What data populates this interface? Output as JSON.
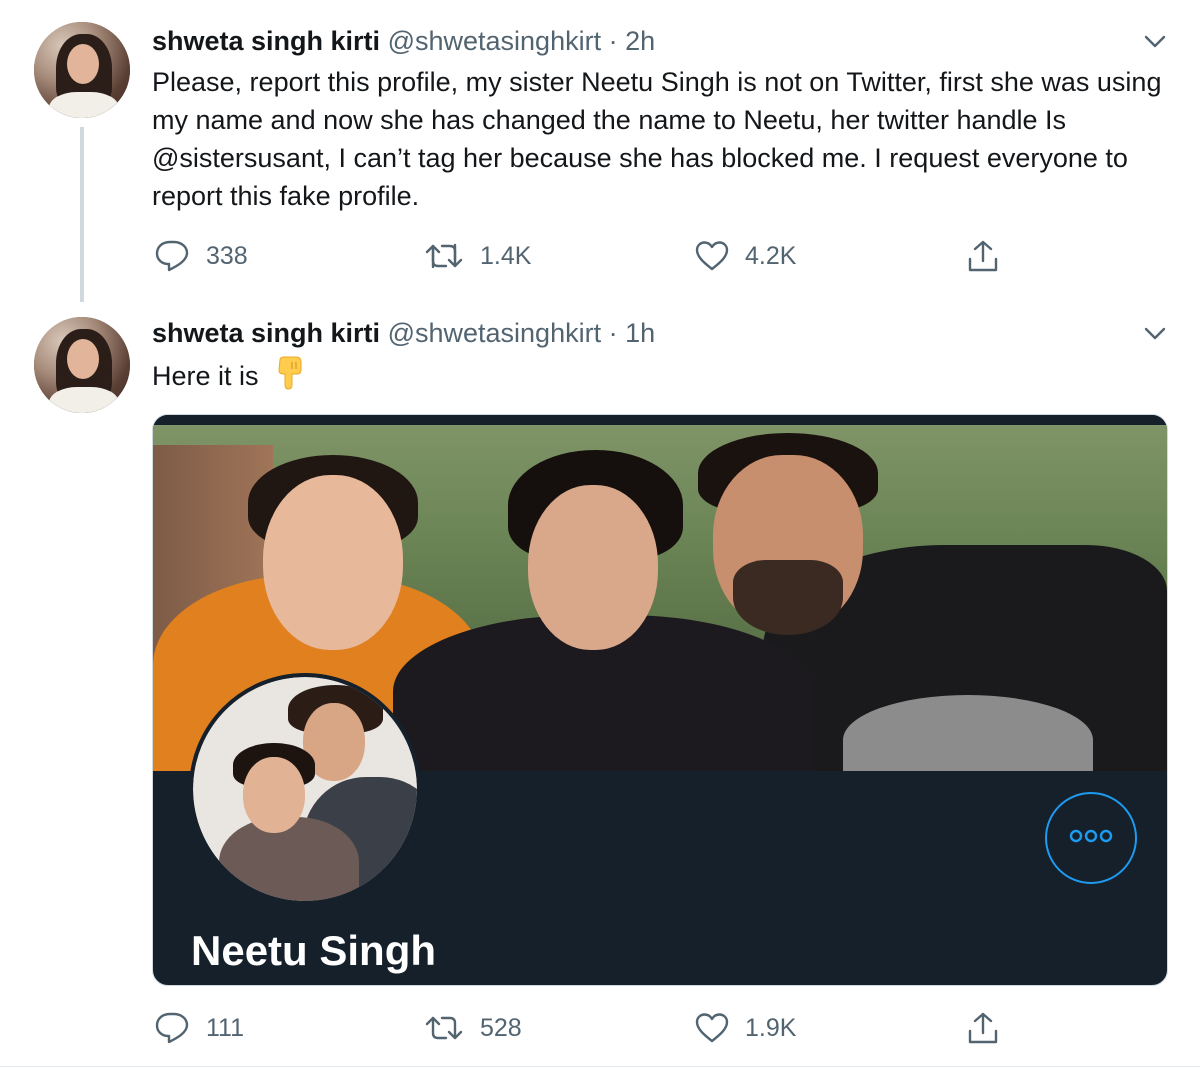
{
  "tweets": [
    {
      "author_name": "shweta singh kirti",
      "handle": "@shwetasinghkirt",
      "separator": "·",
      "time": "2h",
      "text": "Please, report this profile, my sister Neetu Singh is not on Twitter, first she was using my name and now she has changed the name to Neetu, her twitter handle Is @sistersusant, I can’t tag her because she has blocked me. I request everyone to report this fake profile.",
      "replies": "338",
      "retweets": "1.4K",
      "likes": "4.2K"
    },
    {
      "author_name": "shweta singh kirti",
      "handle": "@shwetasinghkirt",
      "separator": "·",
      "time": "1h",
      "text": "Here it is",
      "emoji": "backhand-index-pointing-down",
      "card": {
        "profile_name": "Neetu Singh"
      },
      "replies": "111",
      "retweets": "528",
      "likes": "1.9K"
    }
  ],
  "colors": {
    "text_primary": "#14171a",
    "text_secondary": "#536471",
    "accent": "#1d9bf0",
    "card_background": "#15202b",
    "thread_line": "#cfd9de"
  },
  "icons": [
    "chevron-down-icon",
    "reply-icon",
    "retweet-icon",
    "like-icon",
    "share-icon",
    "more-options-icon"
  ]
}
